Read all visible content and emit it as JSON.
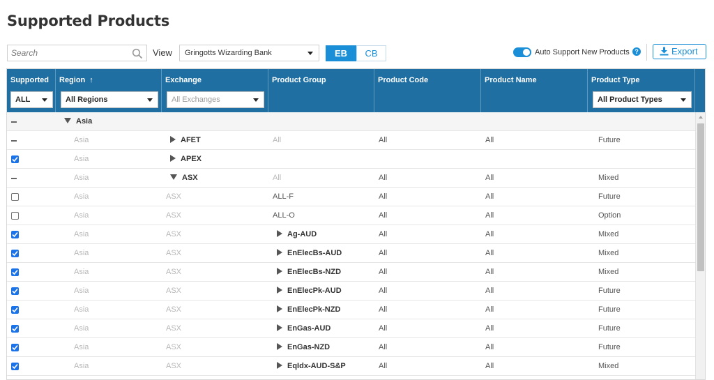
{
  "page": {
    "title": "Supported Products"
  },
  "toolbar": {
    "search_placeholder": "Search",
    "view_label": "View",
    "view_selected": "Gringotts Wizarding Bank",
    "segment_eb": "EB",
    "segment_cb": "CB",
    "segment_active": "EB",
    "auto_support_label": "Auto Support New Products",
    "auto_support_on": true,
    "help_glyph": "?",
    "export_label": "Export"
  },
  "columns": {
    "supported": {
      "label": "Supported",
      "filter": "ALL"
    },
    "region": {
      "label": "Region",
      "sort_glyph": "↑",
      "filter": "All Regions"
    },
    "exchange": {
      "label": "Exchange",
      "filter": "All Exchanges"
    },
    "product_group": {
      "label": "Product Group"
    },
    "product_code": {
      "label": "Product Code"
    },
    "product_name": {
      "label": "Product Name"
    },
    "product_type": {
      "label": "Product Type",
      "filter": "All Product Types"
    }
  },
  "rows": [
    {
      "state": "dash",
      "region": "Asia",
      "region_kind": "group",
      "exchange": "",
      "exchange_kind": "",
      "group": "",
      "group_kind": "",
      "code": "",
      "name": "",
      "type": ""
    },
    {
      "state": "dash",
      "region": "Asia",
      "region_kind": "muted",
      "exchange": "AFET",
      "exchange_kind": "collapsed",
      "group": "All",
      "group_kind": "muted",
      "code": "All",
      "name": "All",
      "type": "Future"
    },
    {
      "state": "checked",
      "region": "Asia",
      "region_kind": "muted",
      "exchange": "APEX",
      "exchange_kind": "collapsed",
      "group": "",
      "group_kind": "",
      "code": "",
      "name": "",
      "type": ""
    },
    {
      "state": "dash",
      "region": "Asia",
      "region_kind": "muted",
      "exchange": "ASX",
      "exchange_kind": "expanded",
      "group": "All",
      "group_kind": "muted",
      "code": "All",
      "name": "All",
      "type": "Mixed"
    },
    {
      "state": "unchecked",
      "region": "Asia",
      "region_kind": "muted",
      "exchange": "ASX",
      "exchange_kind": "muted",
      "group": "ALL-F",
      "group_kind": "plain",
      "code": "All",
      "name": "All",
      "type": "Future"
    },
    {
      "state": "unchecked",
      "region": "Asia",
      "region_kind": "muted",
      "exchange": "ASX",
      "exchange_kind": "muted",
      "group": "ALL-O",
      "group_kind": "plain",
      "code": "All",
      "name": "All",
      "type": "Option"
    },
    {
      "state": "checked",
      "region": "Asia",
      "region_kind": "muted",
      "exchange": "ASX",
      "exchange_kind": "muted",
      "group": "Ag-AUD",
      "group_kind": "collapsed",
      "code": "All",
      "name": "All",
      "type": "Mixed"
    },
    {
      "state": "checked",
      "region": "Asia",
      "region_kind": "muted",
      "exchange": "ASX",
      "exchange_kind": "muted",
      "group": "EnElecBs-AUD",
      "group_kind": "collapsed",
      "code": "All",
      "name": "All",
      "type": "Mixed"
    },
    {
      "state": "checked",
      "region": "Asia",
      "region_kind": "muted",
      "exchange": "ASX",
      "exchange_kind": "muted",
      "group": "EnElecBs-NZD",
      "group_kind": "collapsed",
      "code": "All",
      "name": "All",
      "type": "Mixed"
    },
    {
      "state": "checked",
      "region": "Asia",
      "region_kind": "muted",
      "exchange": "ASX",
      "exchange_kind": "muted",
      "group": "EnElecPk-AUD",
      "group_kind": "collapsed",
      "code": "All",
      "name": "All",
      "type": "Future"
    },
    {
      "state": "checked",
      "region": "Asia",
      "region_kind": "muted",
      "exchange": "ASX",
      "exchange_kind": "muted",
      "group": "EnElecPk-NZD",
      "group_kind": "collapsed",
      "code": "All",
      "name": "All",
      "type": "Future"
    },
    {
      "state": "checked",
      "region": "Asia",
      "region_kind": "muted",
      "exchange": "ASX",
      "exchange_kind": "muted",
      "group": "EnGas-AUD",
      "group_kind": "collapsed",
      "code": "All",
      "name": "All",
      "type": "Future"
    },
    {
      "state": "checked",
      "region": "Asia",
      "region_kind": "muted",
      "exchange": "ASX",
      "exchange_kind": "muted",
      "group": "EnGas-NZD",
      "group_kind": "collapsed",
      "code": "All",
      "name": "All",
      "type": "Future"
    },
    {
      "state": "checked",
      "region": "Asia",
      "region_kind": "muted",
      "exchange": "ASX",
      "exchange_kind": "muted",
      "group": "EqIdx-AUD-S&P",
      "group_kind": "collapsed",
      "code": "All",
      "name": "All",
      "type": "Mixed"
    }
  ],
  "theme": {
    "header_bg": "#1f6fa3",
    "accent": "#1a8fd8",
    "checkbox": "#1a73e8"
  },
  "icons": {
    "search": "search-icon",
    "export": "download-icon",
    "help": "help-icon"
  }
}
